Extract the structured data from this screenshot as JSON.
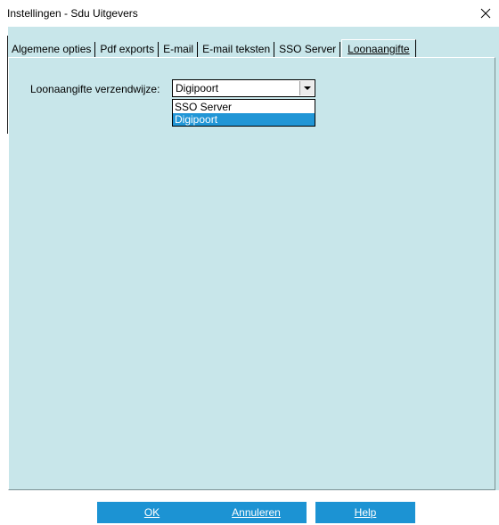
{
  "window": {
    "title": "Instellingen - Sdu Uitgevers"
  },
  "tabs": [
    {
      "label": "Algemene opties",
      "active": false
    },
    {
      "label": "Pdf exports",
      "active": false
    },
    {
      "label": "E-mail",
      "active": false
    },
    {
      "label": "E-mail teksten",
      "active": false
    },
    {
      "label": "SSO Server",
      "active": false
    },
    {
      "label": "Loonaangifte",
      "active": true
    }
  ],
  "form": {
    "label": "Loonaangifte verzendwijze:",
    "selected": "Digipoort",
    "options": [
      "SSO Server",
      "Digipoort"
    ]
  },
  "buttons": {
    "ok": "OK",
    "cancel": "Annuleren",
    "help": "Help"
  },
  "colors": {
    "panel_bg": "#c8e6ea",
    "button_bg": "#1c93d3",
    "selection": "#2196d6"
  }
}
